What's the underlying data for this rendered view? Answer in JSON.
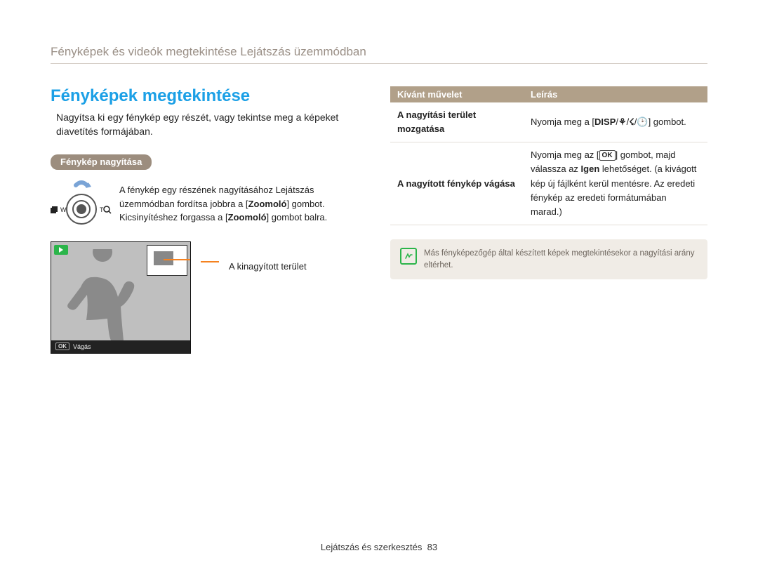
{
  "header": "Fényképek és videók megtekintése Lejátszás üzemmódban",
  "section_title": "Fényképek megtekintése",
  "intro": "Nagyítsa ki egy fénykép egy részét, vagy tekintse meg a képeket diavetítés formájában.",
  "pill": "Fénykép nagyítása",
  "zoom_text_1": "A fénykép egy részének nagyításához Lejátszás üzemmódban fordítsa jobbra a [",
  "zoom_bold_1": "Zoomoló",
  "zoom_text_2": "] gombot. Kicsinyítéshez forgassa a [",
  "zoom_bold_2": "Zoomoló",
  "zoom_text_3": "] gombot balra.",
  "preview": {
    "label": "A kinagyított terület",
    "ok": "OK",
    "cut": "Vágás",
    "w": "W",
    "t": "T"
  },
  "table": {
    "head_left": "Kívánt művelet",
    "head_right": "Leírás",
    "row1_left": "A nagyítási terület mozgatása",
    "row1_right_a": "Nyomja meg a [",
    "row1_disp": "DISP",
    "row1_right_b": "] gombot.",
    "row2_left": "A nagyított fénykép vágása",
    "row2_right_a": "Nyomja meg az [",
    "row2_ok": "OK",
    "row2_right_b": "] gombot, majd válassza az ",
    "row2_yes": "Igen",
    "row2_right_c": " lehetőséget. (a kivágott kép új fájlként kerül mentésre. Az eredeti fénykép az eredeti formátumában marad.)"
  },
  "note": "Más fényképezőgép által készített képek megtekintésekor a nagyítási arány eltérhet.",
  "footer_label": "Lejátszás és szerkesztés",
  "footer_page": "83"
}
